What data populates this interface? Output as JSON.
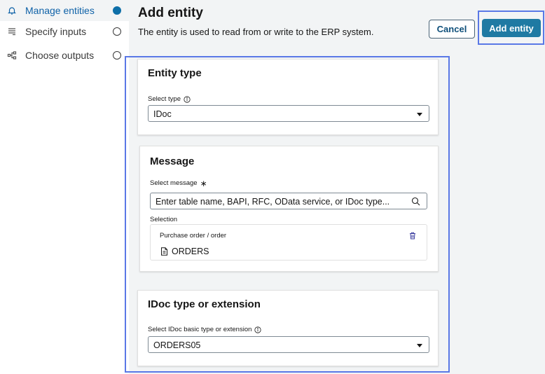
{
  "sidebar": {
    "steps": [
      {
        "label": "Manage entities",
        "icon": "bell-icon",
        "state": "active"
      },
      {
        "label": "Specify inputs",
        "icon": "list-icon",
        "state": "pending"
      },
      {
        "label": "Choose outputs",
        "icon": "share-nodes-icon",
        "state": "pending"
      }
    ]
  },
  "header": {
    "title": "Add entity",
    "description": "The entity is used to read from or write to the ERP system.",
    "cancel_label": "Cancel",
    "add_label": "Add entity"
  },
  "entity_type": {
    "title": "Entity type",
    "select_label": "Select type",
    "selected_value": "IDoc"
  },
  "message": {
    "title": "Message",
    "select_label": "Select message",
    "required_mark": "∗",
    "search_placeholder": "Enter table name, BAPI, RFC, OData service, or IDoc type...",
    "selection_label": "Selection",
    "selection": {
      "category": "Purchase order / order",
      "name": "ORDERS"
    }
  },
  "idoc": {
    "title": "IDoc type or extension",
    "select_label": "Select IDoc basic type or extension",
    "selected_value": "ORDERS05"
  },
  "colors": {
    "accent": "#1f7aa3",
    "highlight": "#5a78e6",
    "active_step": "#0e6fa8"
  }
}
